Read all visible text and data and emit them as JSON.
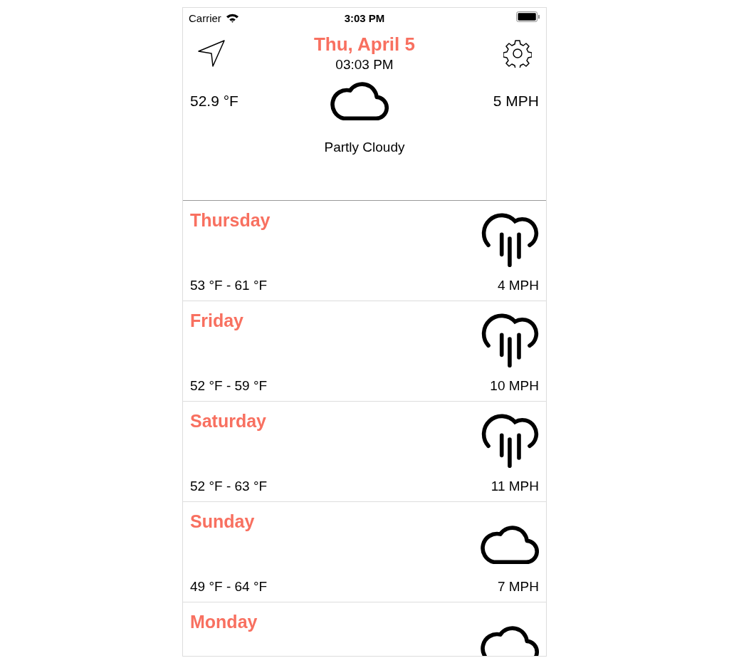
{
  "status_bar": {
    "carrier": "Carrier",
    "time": "3:03 PM"
  },
  "header": {
    "date": "Thu, April 5",
    "time": "03:03 PM"
  },
  "current": {
    "temperature": "52.9 °F",
    "wind": "5 MPH",
    "condition": "Partly Cloudy",
    "icon": {
      "kind": "cloud"
    }
  },
  "forecast": [
    {
      "day": "Thursday",
      "temperatures": "53 °F - 61 °F",
      "wind": "4 MPH",
      "icon": {
        "kind": "rain"
      }
    },
    {
      "day": "Friday",
      "temperatures": "52 °F - 59 °F",
      "wind": "10 MPH",
      "icon": {
        "kind": "rain"
      }
    },
    {
      "day": "Saturday",
      "temperatures": "52 °F - 63 °F",
      "wind": "11 MPH",
      "icon": {
        "kind": "rain"
      }
    },
    {
      "day": "Sunday",
      "temperatures": "49 °F - 64 °F",
      "wind": "7 MPH",
      "icon": {
        "kind": "cloud"
      }
    },
    {
      "day": "Monday",
      "icon": {
        "kind": "cloud"
      }
    }
  ]
}
